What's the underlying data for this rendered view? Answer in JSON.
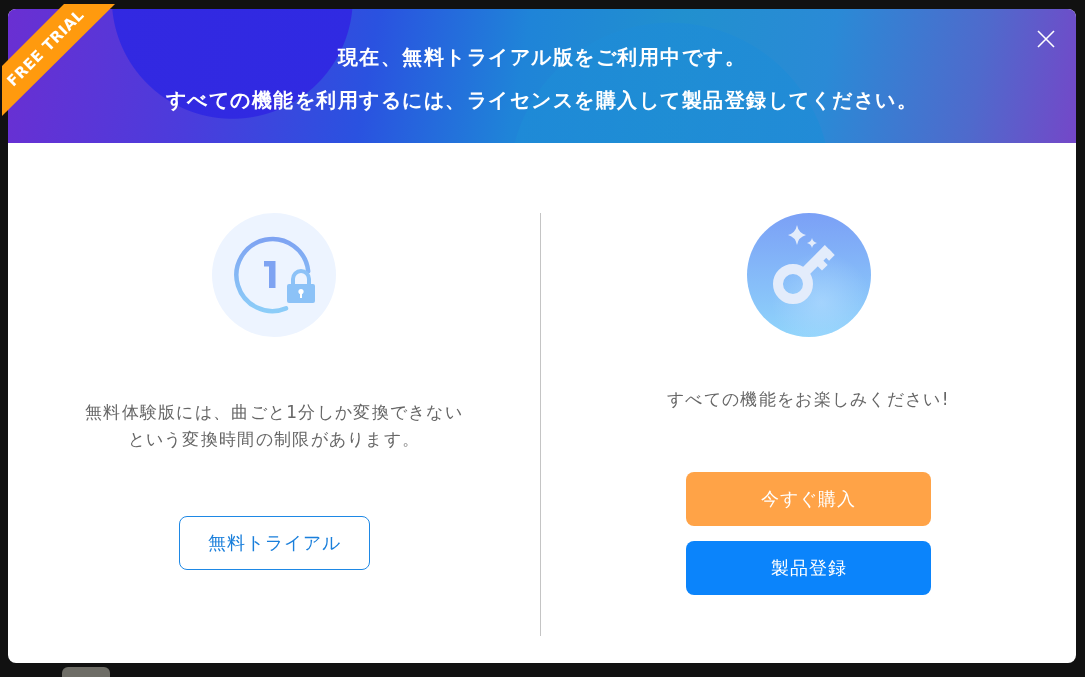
{
  "dialog": {
    "ribbon": "FREE TRIAL",
    "header": {
      "lines": [
        "現在、無料トライアル版をご利用中です。",
        "すべての機能を利用するには、ライセンスを購入して製品登録してください。"
      ]
    },
    "options": [
      {
        "kind": "trial",
        "description": "無料体験版には、曲ごと1分しか変換できないという変換時間の制限があります。",
        "buttons": [
          {
            "kind": "outline",
            "label": "無料トライアル"
          }
        ]
      },
      {
        "kind": "license",
        "description": "すべての機能をお楽しみください!",
        "buttons": [
          {
            "kind": "buy",
            "label": "今すぐ購入"
          },
          {
            "kind": "register",
            "label": "製品登録"
          }
        ]
      }
    ]
  }
}
